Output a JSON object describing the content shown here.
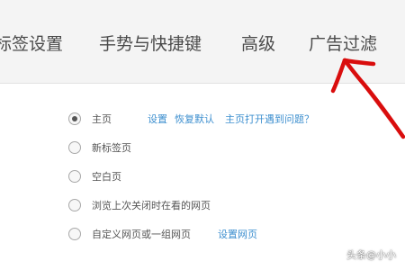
{
  "tabs": [
    {
      "label": "标签设置"
    },
    {
      "label": "手势与快捷键"
    },
    {
      "label": "高级"
    },
    {
      "label": "广告过滤"
    }
  ],
  "startup_options": [
    {
      "label": "主页",
      "checked": true
    },
    {
      "label": "新标签页",
      "checked": false
    },
    {
      "label": "空白页",
      "checked": false
    },
    {
      "label": "浏览上次关闭时在看的网页",
      "checked": false
    },
    {
      "label": "自定义网页或一组网页",
      "checked": false
    }
  ],
  "links": {
    "settings": "设置",
    "restore_default": "恢复默认",
    "homepage_problem": "主页打开遇到问题？",
    "set_pages": "设置网页"
  },
  "watermark": "头条@小小",
  "colors": {
    "link": "#3d8fcf",
    "annotation": "#d90d0d",
    "tabbar_bg": "#f4f4f4"
  }
}
